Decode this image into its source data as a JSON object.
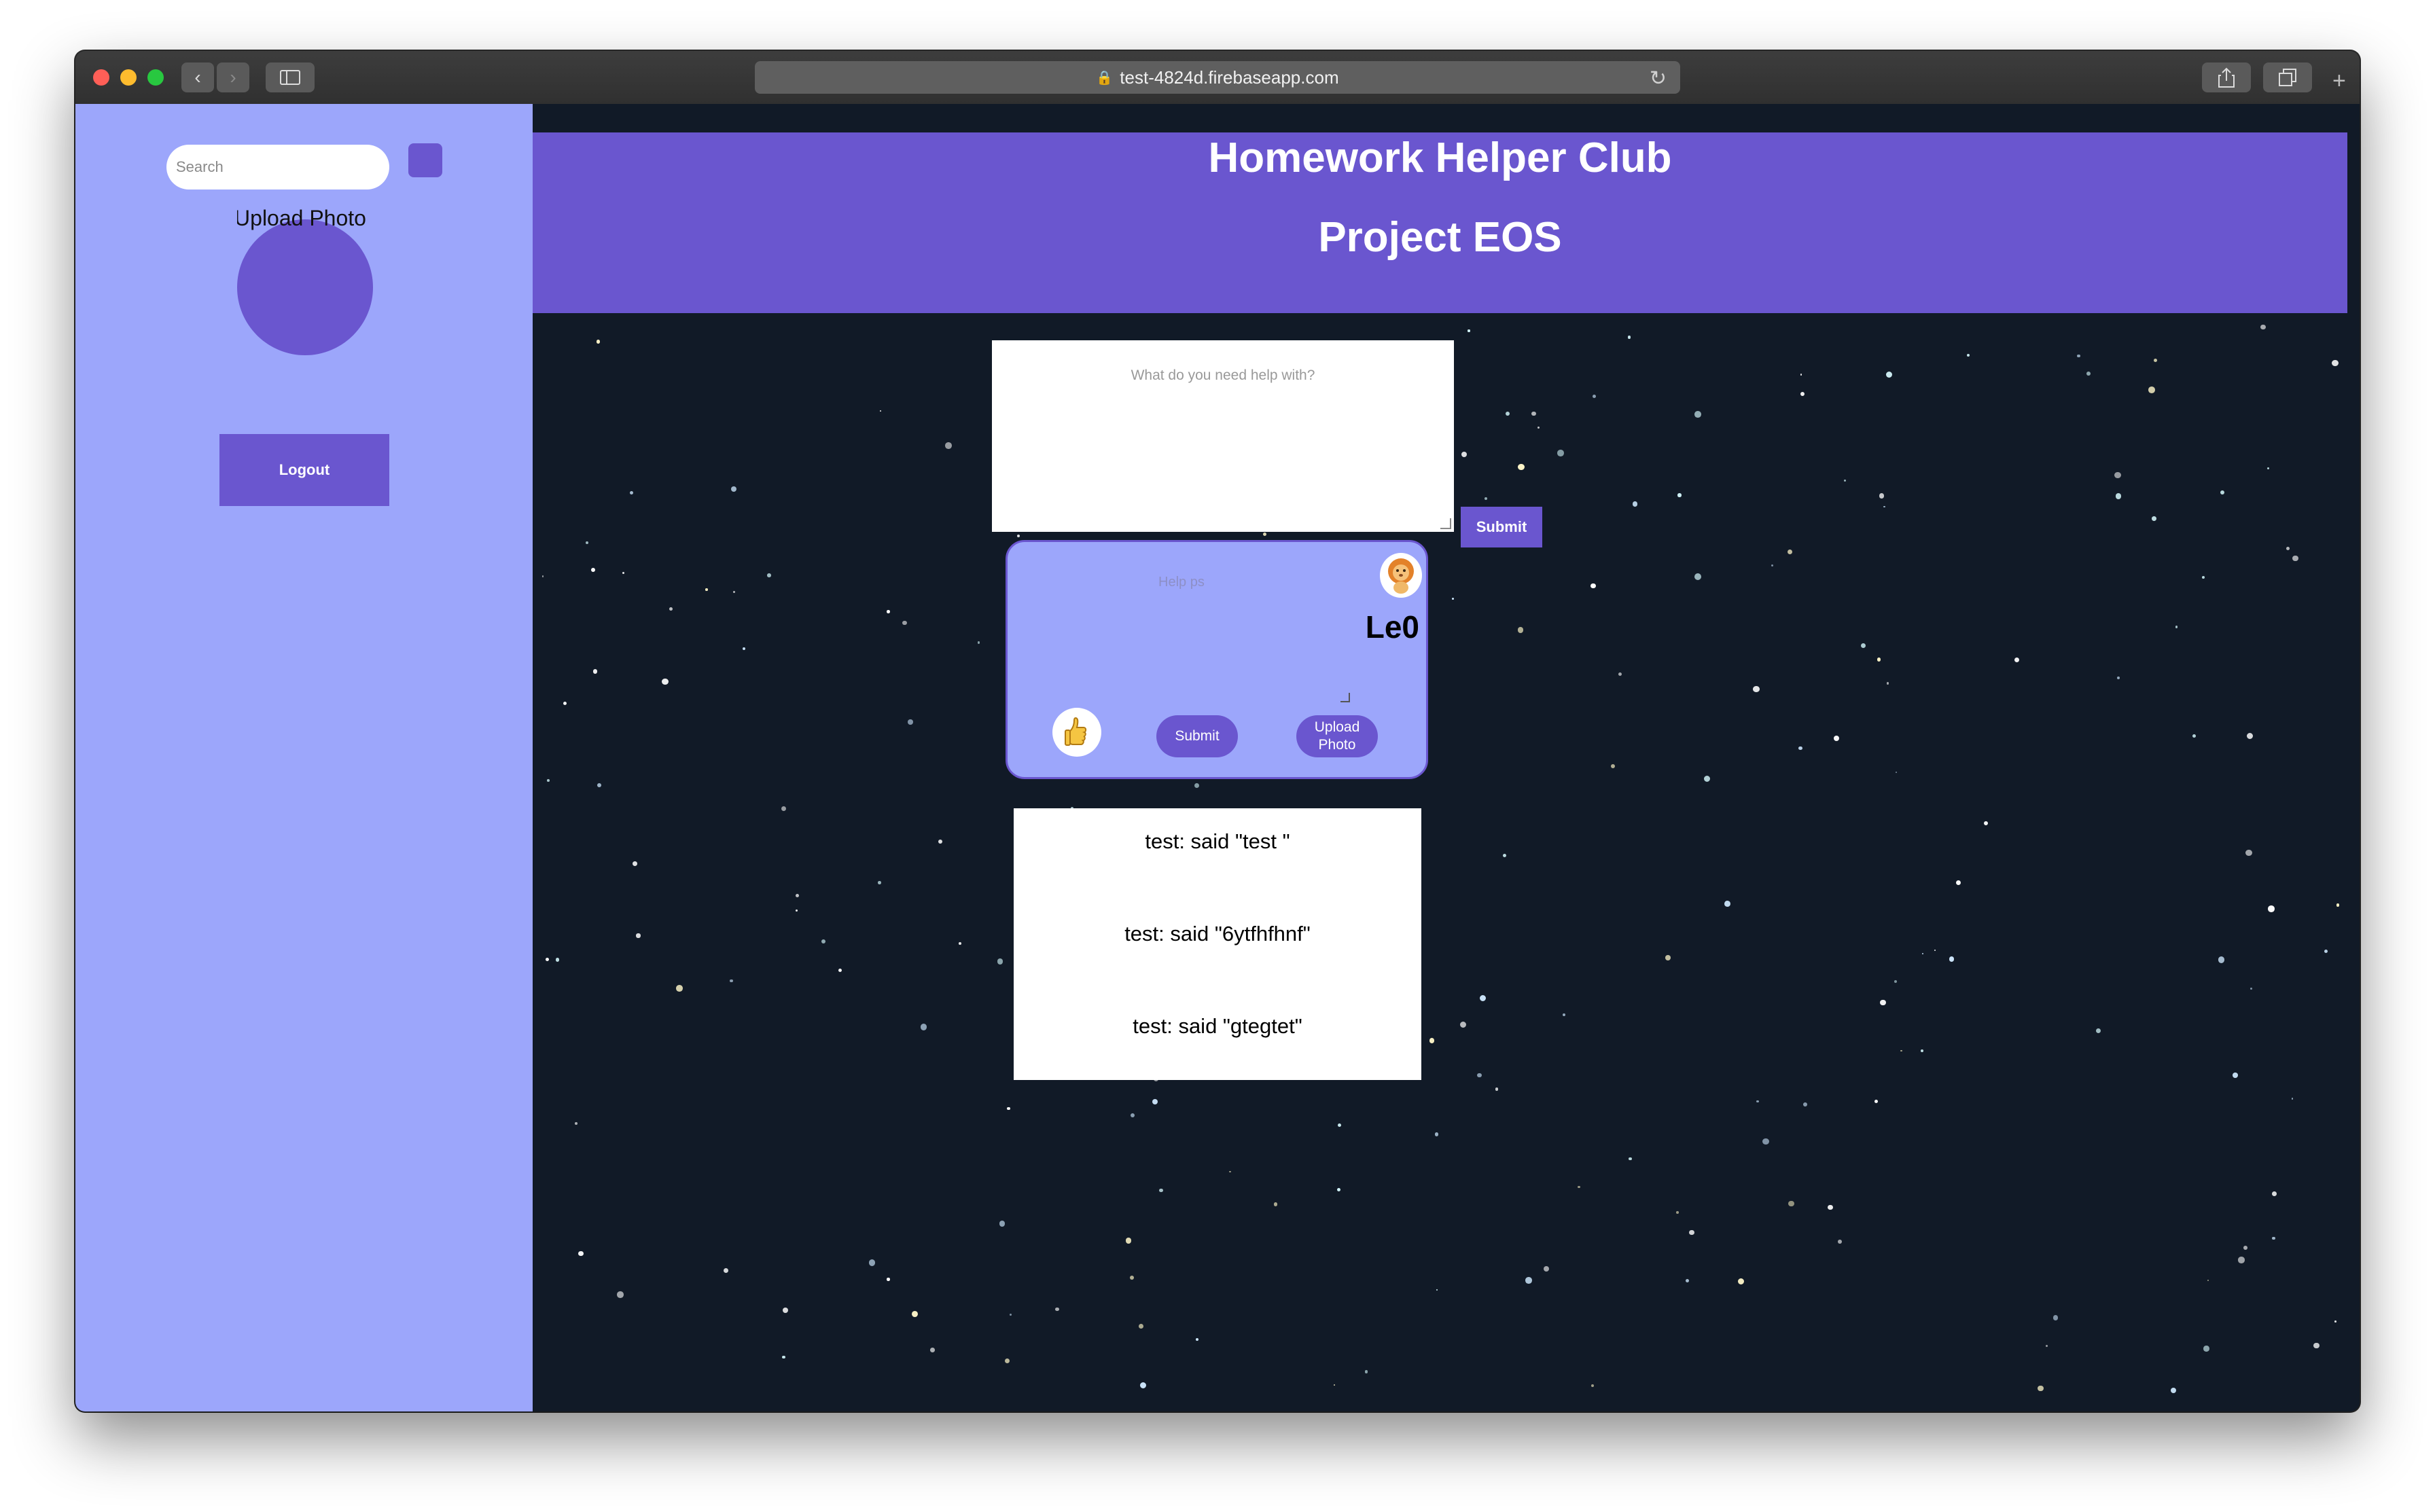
{
  "browser": {
    "url": "test-4824d.firebaseapp.com"
  },
  "sidebar": {
    "search_placeholder": "Search",
    "upload_photo_label": "Upload Photo",
    "logout_label": "Logout"
  },
  "header": {
    "title": "Homework Helper Club",
    "subtitle": "Project EOS"
  },
  "question": {
    "placeholder": "What do you need help with?",
    "submit_label": "Submit"
  },
  "post": {
    "placeholder": "Help ps",
    "username": "Le0",
    "submit_label": "Submit",
    "upload_label": "Upload Photo"
  },
  "messages": [
    "test: said \"test \"",
    "test: said \"6ytfhfhnf\"",
    "test: said \"gtegtet\""
  ],
  "colors": {
    "accent": "#6a56cf",
    "sidebar_bg": "#9ca6fb",
    "space_bg": "#111a27"
  }
}
